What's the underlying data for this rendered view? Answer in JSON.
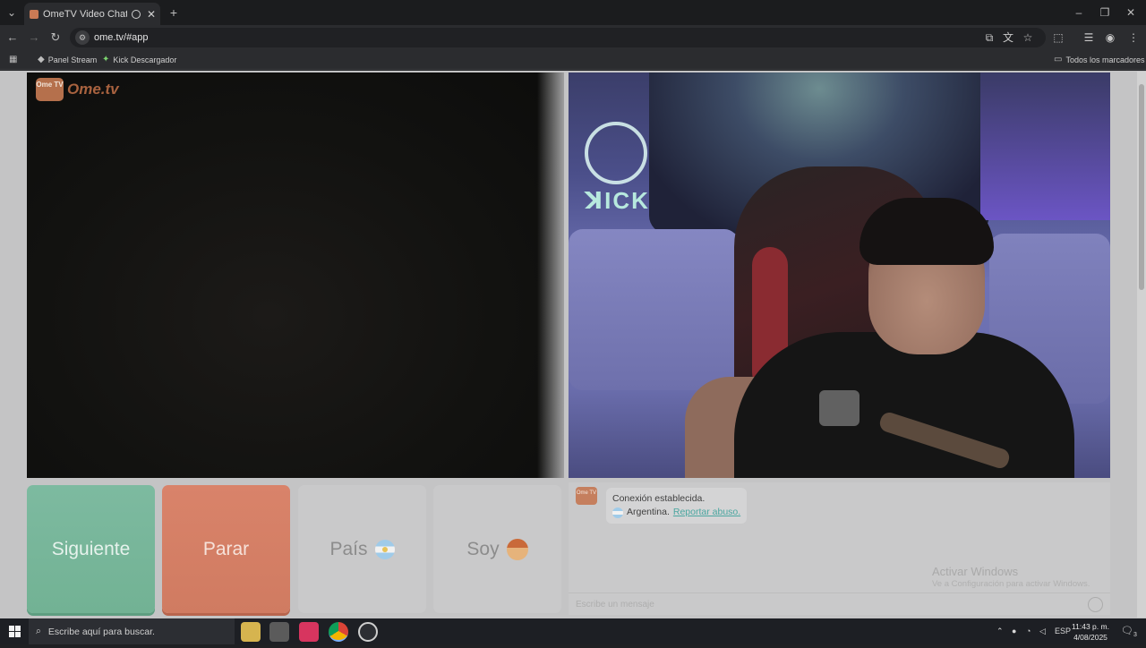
{
  "browser": {
    "tab_title": "OmeTV Video Chat — Ome",
    "tab_close": "✕",
    "new_tab": "+",
    "url": "ome.tv/#app",
    "bookmarks": [
      {
        "label": "Panel Stream"
      },
      {
        "label": "Kick Descargador"
      }
    ],
    "all_bookmarks": "Todos los marcadores"
  },
  "app": {
    "logo_text": "Ome.tv",
    "logo_badge": "Ome TV",
    "buttons": {
      "next": "Siguiente",
      "stop": "Parar",
      "country": "País",
      "gender": "Soy"
    },
    "chat": {
      "connected": "Conexión establecida.",
      "country": "Argentina.",
      "report_link": "Reportar abuso.",
      "input_placeholder": "Escribe un mensaje"
    },
    "watermark": {
      "line1": "Activar Windows",
      "line2": "Ve a Configuración para activar Windows."
    }
  },
  "taskbar": {
    "search_placeholder": "Escribe aquí para buscar.",
    "language": "ESP",
    "time": "11:43 p. m.",
    "date": "4/08/2025",
    "notifications": "3"
  },
  "colors": {
    "next_button": "#7dbaa0",
    "stop_button": "#d9836a",
    "link": "#4aa6a0",
    "brand": "#b5704c"
  }
}
